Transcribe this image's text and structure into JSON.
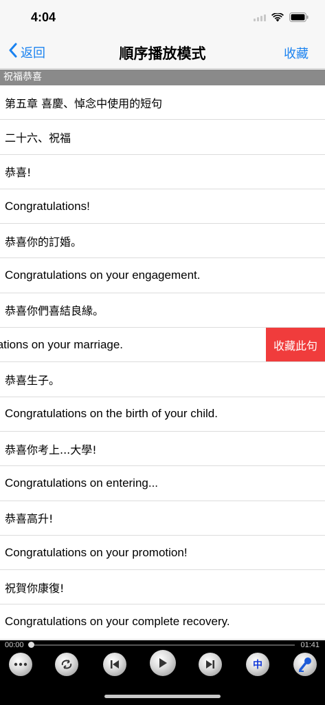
{
  "status": {
    "time": "4:04"
  },
  "nav": {
    "back_label": "返回",
    "title": "順序播放模式",
    "favorite_label": "收藏"
  },
  "section": {
    "title": "祝福恭喜"
  },
  "rows": [
    {
      "text": "第五章  喜慶、悼念中使用的短句",
      "lang": "zh"
    },
    {
      "text": "二十六、祝福",
      "lang": "zh"
    },
    {
      "text": "恭喜!",
      "lang": "zh"
    },
    {
      "text": "Congratulations!",
      "lang": "en"
    },
    {
      "text": "恭喜你的訂婚。",
      "lang": "zh"
    },
    {
      "text": "Congratulations on your engagement.",
      "lang": "en"
    },
    {
      "text": "恭喜你們喜結良緣。",
      "lang": "zh"
    },
    {
      "text": "Congratulations on your marriage.",
      "lang": "en",
      "swiped": true,
      "action": "收藏此句"
    },
    {
      "text": "恭喜生子。",
      "lang": "zh"
    },
    {
      "text": "Congratulations on the birth of your child.",
      "lang": "en"
    },
    {
      "text": "恭喜你考上...大學!",
      "lang": "zh"
    },
    {
      "text": "Congratulations on entering...",
      "lang": "en"
    },
    {
      "text": "恭喜高升!",
      "lang": "zh"
    },
    {
      "text": "Congratulations on your promotion!",
      "lang": "en"
    },
    {
      "text": "祝賀你康復!",
      "lang": "zh"
    },
    {
      "text": "Congratulations on your complete recovery.",
      "lang": "en"
    }
  ],
  "player": {
    "current_time": "00:00",
    "total_time": "01:41",
    "progress": 0.0,
    "language_label": "中",
    "controls": [
      "more-icon",
      "repeat-icon",
      "previous-icon",
      "play-icon",
      "next-icon",
      "language-toggle",
      "microphone-icon"
    ]
  },
  "colors": {
    "accent": "#1a82f0",
    "swipe_action": "#f03c3c",
    "section_bg": "#8a8a8a"
  }
}
